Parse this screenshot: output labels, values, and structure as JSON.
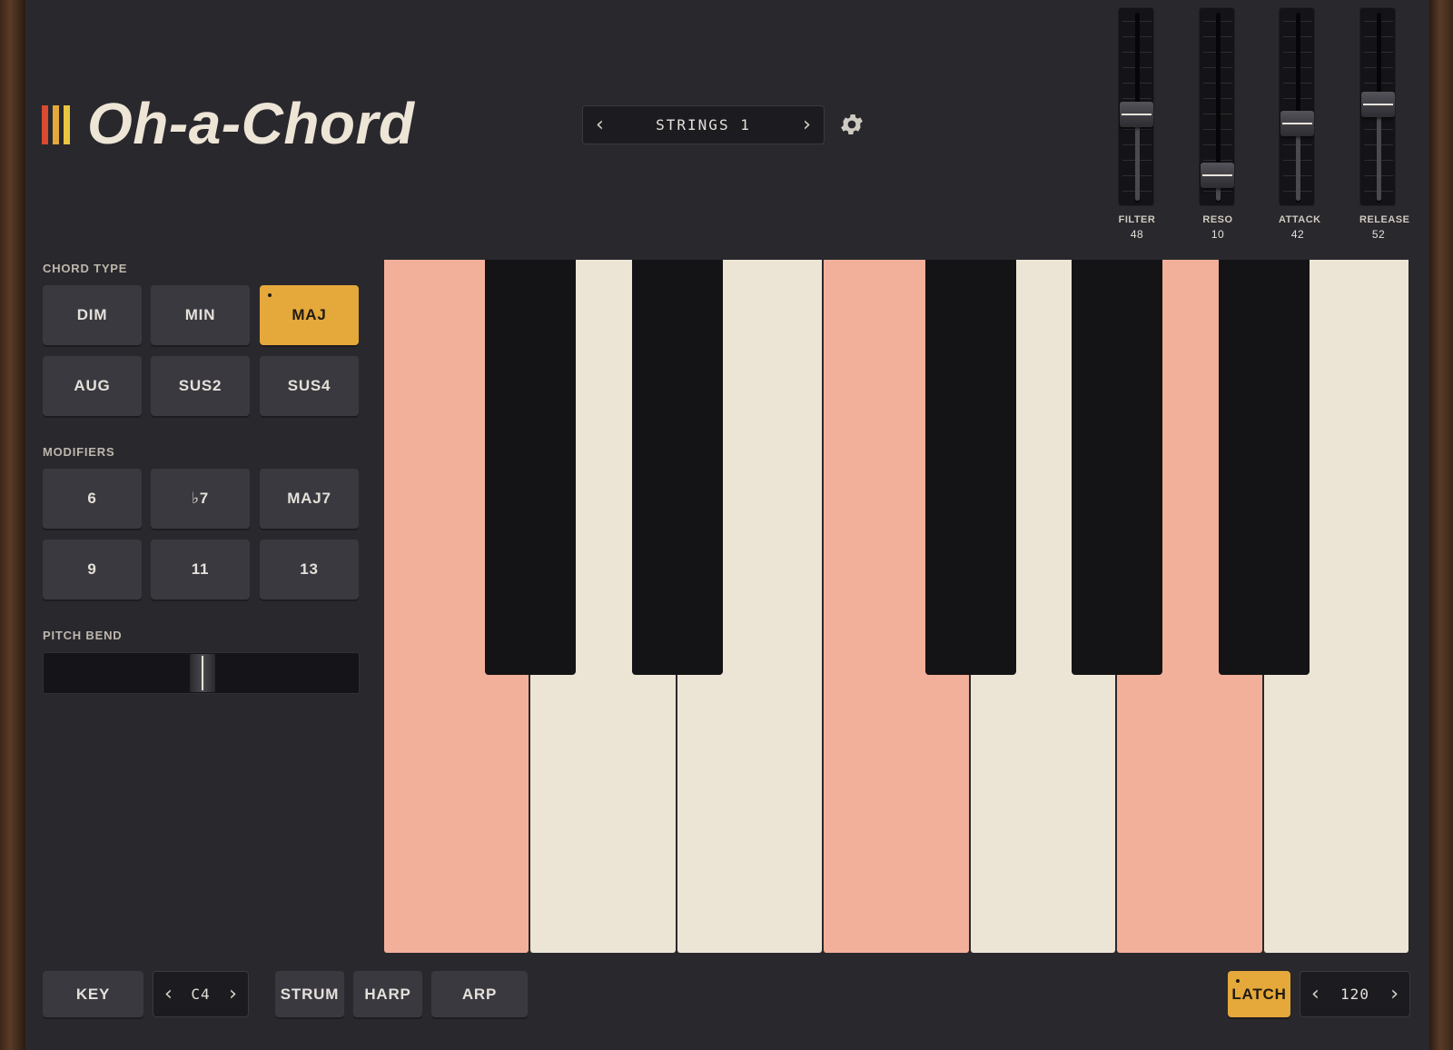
{
  "app": {
    "title": "Oh-a-Chord",
    "logo_colors": [
      "#d94a30",
      "#e5a83a",
      "#e8c640"
    ]
  },
  "preset": {
    "name": "STRINGS 1",
    "prev_icon": "chevron-left-icon",
    "next_icon": "chevron-right-icon"
  },
  "settings": {
    "icon": "gear-icon"
  },
  "faders": [
    {
      "label": "FILTER",
      "value": "48"
    },
    {
      "label": "RESO",
      "value": "10"
    },
    {
      "label": "ATTACK",
      "value": "42"
    },
    {
      "label": "RELEASE",
      "value": "52"
    }
  ],
  "chord_type": {
    "label": "CHORD TYPE",
    "buttons": [
      "DIM",
      "MIN",
      "MAJ",
      "AUG",
      "SUS2",
      "SUS4"
    ],
    "active": "MAJ"
  },
  "modifiers": {
    "label": "MODIFIERS",
    "buttons": [
      "6",
      "♭7",
      "MAJ7",
      "9",
      "11",
      "13"
    ]
  },
  "pitch_bend": {
    "label": "PITCH BEND",
    "value": 0
  },
  "keyboard": {
    "white_keys": [
      "lit",
      "plain",
      "plain",
      "lit",
      "plain",
      "lit",
      "plain"
    ],
    "black_keys": 5
  },
  "bottom": {
    "key_label": "KEY",
    "octave": "C4",
    "strum_label": "STRUM",
    "harp_label": "HARP",
    "arp_label": "ARP",
    "latch_label": "LATCH",
    "tempo": "120"
  },
  "colors": {
    "accent": "#e5a83a",
    "highlight_key": "#f2af9a",
    "white_key": "#ece4d5",
    "black_key": "#141316",
    "panel": "#29282d"
  }
}
